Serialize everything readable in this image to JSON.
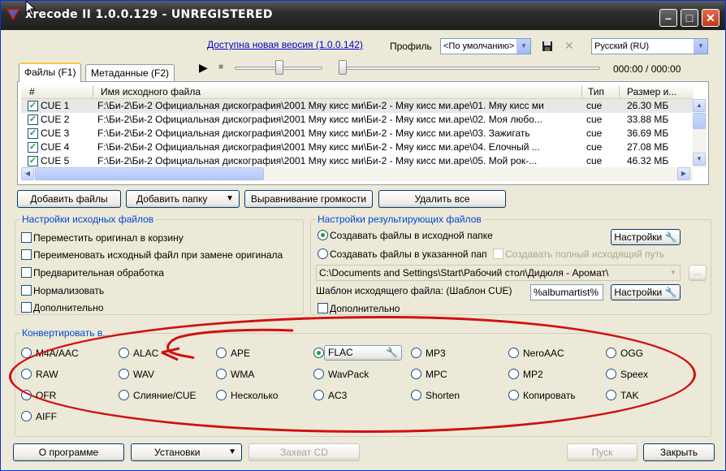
{
  "window": {
    "title": "xrecode II 1.0.0.129 - UNREGISTERED",
    "min_glyph": "–",
    "max_glyph": "□",
    "close_glyph": "✕"
  },
  "topbar": {
    "update_link": "Доступна новая версия (1.0.0.142)",
    "profile_label": "Профиль",
    "profile_value": "<По умолчанию>",
    "language_value": "Русский (RU)"
  },
  "tabs": [
    {
      "label": "Файлы (F1)",
      "active": true
    },
    {
      "label": "Метаданные (F2)",
      "active": false
    }
  ],
  "player": {
    "time": "000:00 / 000:00",
    "position_fraction": 0.35
  },
  "file_list": {
    "columns": [
      "#",
      "Имя исходного файла",
      "Тип",
      "Размер и..."
    ],
    "rows": [
      {
        "num": "CUE 1",
        "name": "F:\\Би-2\\Би-2 Официальная дискография\\2001 Мяу кисс ми\\Би-2 - Мяу кисс ми.ape\\01. Мяу кисс ми",
        "type": "cue",
        "size": "26.30 МБ"
      },
      {
        "num": "CUE 2",
        "name": "F:\\Би-2\\Би-2 Официальная дискография\\2001 Мяу кисс ми\\Би-2 - Мяу кисс ми.ape\\02. Моя любо...",
        "type": "cue",
        "size": "33.88 МБ"
      },
      {
        "num": "CUE 3",
        "name": "F:\\Би-2\\Би-2 Официальная дискография\\2001 Мяу кисс ми\\Би-2 - Мяу кисс ми.ape\\03. Зажигать",
        "type": "cue",
        "size": "36.69 МБ"
      },
      {
        "num": "CUE 4",
        "name": "F:\\Би-2\\Би-2 Официальная дискография\\2001 Мяу кисс ми\\Би-2 - Мяу кисс ми.ape\\04. Елочный ...",
        "type": "cue",
        "size": "27.08 МБ"
      },
      {
        "num": "CUE 5",
        "name": "F:\\Би-2\\Би-2 Официальная дискография\\2001 Мяу кисс ми\\Би-2 - Мяу кисс ми.ape\\05. Мой рок-...",
        "type": "cue",
        "size": "46.32 МБ"
      }
    ]
  },
  "action_buttons": {
    "add_files": "Добавить файлы",
    "add_folder": "Добавить папку",
    "normalize_volume": "Выравнивание громкости",
    "delete_all": "Удалить все"
  },
  "source_settings": {
    "title": "Настройки исходных файлов",
    "options": [
      "Переместить оригинал в корзину",
      "Переименовать исходный файл при замене оригинала",
      "Предварительная обработка",
      "Нормализовать",
      "Дополнительно"
    ]
  },
  "output_settings": {
    "title": "Настройки результирующих файлов",
    "create_in_source": "Создавать файлы в исходной папке",
    "create_in_folder": "Создавать файлы в указанной пап",
    "create_full_path": "Создавать полный исходящий путь",
    "settings_button": "Настройки",
    "path_value": "C:\\Documents and Settings\\Start\\Рабочий стол\\Дидюля - Аромат\\",
    "browse_button": "...",
    "template_label": "Шаблон исходящего файла: (Шаблон CUE)",
    "template_value": "%albumartist%",
    "settings_button2": "Настройки",
    "advanced": "Дополнительно"
  },
  "convert": {
    "title": "Конвертировать в...",
    "formats": [
      [
        "M4A/AAC",
        "ALAC",
        "APE",
        "FLAC",
        "MP3",
        "NeroAAC",
        "OGG"
      ],
      [
        "RAW",
        "WAV",
        "WMA",
        "WavPack",
        "MPC",
        "MP2",
        "Speex"
      ],
      [
        "OFR",
        "Слияние/CUE",
        "Несколько",
        "AC3",
        "Shorten",
        "Копировать",
        "TAK"
      ],
      [
        "AIFF"
      ]
    ],
    "selected": "FLAC"
  },
  "bottom": {
    "about": "О программе",
    "settings": "Установки",
    "capture_cd": "Захват CD",
    "start": "Пуск",
    "close": "Закрыть"
  },
  "colors": {
    "annotation": "#d01010",
    "group_title": "#0046d5"
  }
}
